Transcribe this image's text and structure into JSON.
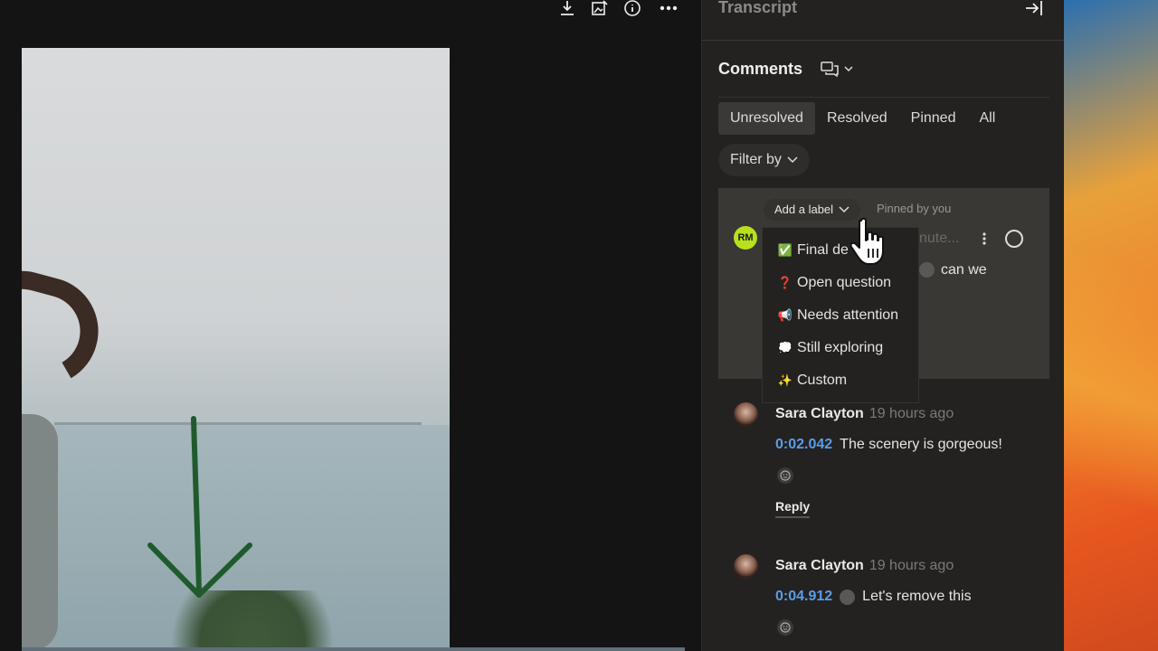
{
  "toolbar": {
    "icons": [
      "download-icon",
      "edit-image-icon",
      "info-icon",
      "more-icon"
    ]
  },
  "panel": {
    "transcript_title": "Transcript",
    "comments_title": "Comments",
    "tabs": [
      {
        "label": "Unresolved",
        "active": true
      },
      {
        "label": "Resolved",
        "active": false
      },
      {
        "label": "Pinned",
        "active": false
      },
      {
        "label": "All",
        "active": false
      }
    ],
    "filter_label": "Filter by"
  },
  "pinned_comment": {
    "add_label": "Add a label",
    "pinned_text": "Pinned by you",
    "avatar_initials": "RM",
    "partial_text": "nute...",
    "partial_body": "can we"
  },
  "label_menu": {
    "items": [
      {
        "emoji": "✅",
        "label": "Final decision",
        "visible_label": "Final de"
      },
      {
        "emoji": "❓",
        "label": "Open question"
      },
      {
        "emoji": "📢",
        "label": "Needs attention"
      },
      {
        "emoji": "💭",
        "label": "Still exploring"
      },
      {
        "emoji": "✨",
        "label": "Custom"
      }
    ]
  },
  "comments": [
    {
      "author": "Sara Clayton",
      "time": "19 hours ago",
      "timestamp": "0:02.042",
      "text": "The scenery is gorgeous!",
      "reply_label": "Reply"
    },
    {
      "author": "Sara Clayton",
      "time": "19 hours ago",
      "timestamp": "0:04.912",
      "text": "Let's remove this"
    }
  ],
  "colors": {
    "timestamp_blue": "#5b9de9",
    "avatar_rm": "#b8e11c",
    "annotation_green": "#1f5a2c"
  }
}
